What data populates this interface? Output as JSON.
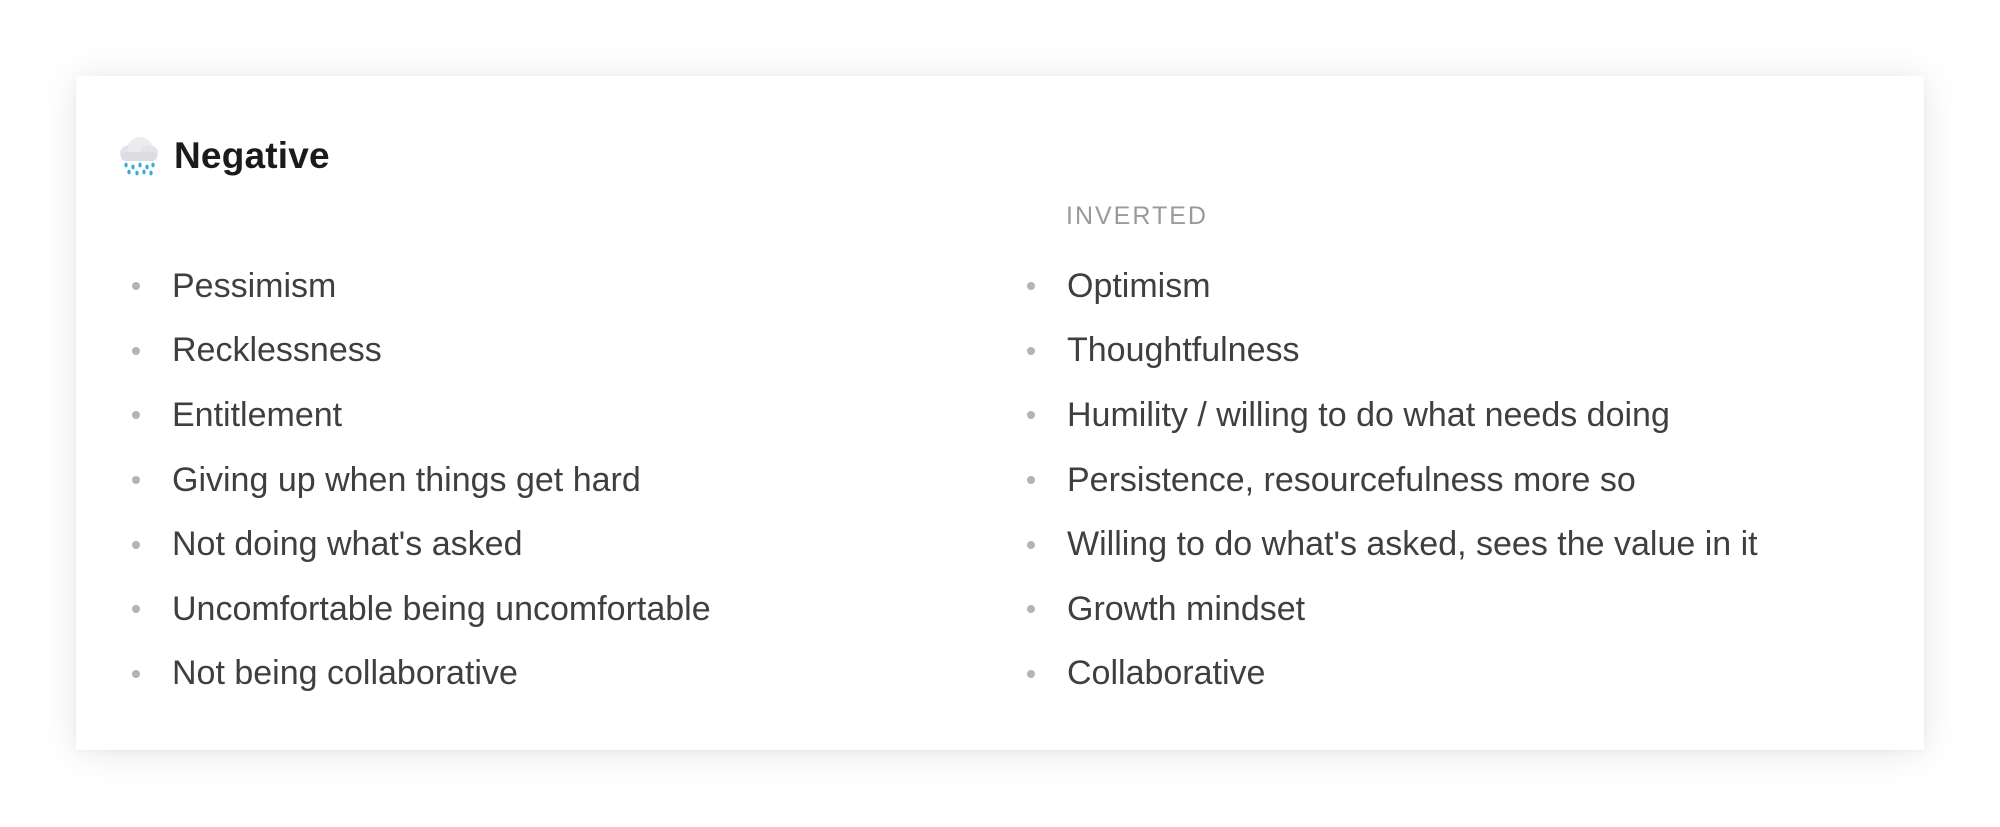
{
  "section": {
    "icon": "cloud-rain-icon",
    "title": "Negative"
  },
  "right_column_label": "INVERTED",
  "left_items": [
    "Pessimism",
    "Recklessness",
    "Entitlement",
    "Giving up when things get hard",
    "Not doing what's asked",
    "Uncomfortable being uncomfortable",
    "Not being collaborative"
  ],
  "right_items": [
    "Optimism",
    "Thoughtfulness",
    "Humility / willing to do what needs doing",
    "Persistence, resourcefulness more so",
    "Willing to do what's asked, sees the value in it",
    "Growth mindset",
    "Collaborative"
  ],
  "colors": {
    "title": "#1b1b1b",
    "text": "#3f3f3f",
    "muted": "#9a9a9a",
    "bullet": "#b4b4b4",
    "cloud": "#e6e6ea",
    "rain": "#3aaed8"
  }
}
